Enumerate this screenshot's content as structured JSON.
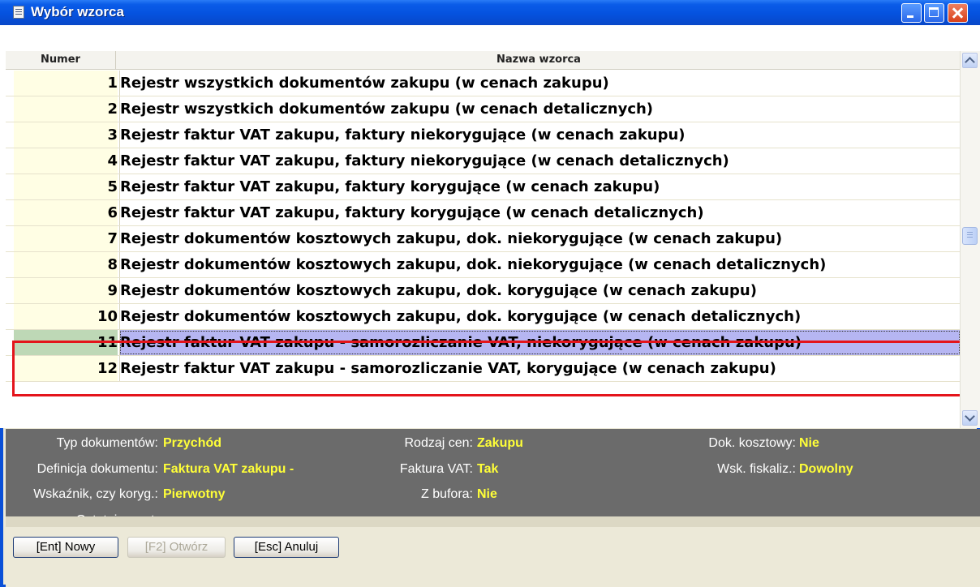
{
  "window": {
    "title": "Wybór wzorca"
  },
  "table": {
    "columns": [
      "Numer",
      "Nazwa wzorca"
    ],
    "selected_index": 10,
    "rows": [
      {
        "number": "1",
        "name": "Rejestr wszystkich dokumentów zakupu (w cenach zakupu)"
      },
      {
        "number": "2",
        "name": "Rejestr wszystkich dokumentów zakupu (w cenach detalicznych)"
      },
      {
        "number": "3",
        "name": "Rejestr faktur VAT zakupu, faktury niekorygujące (w cenach zakupu)"
      },
      {
        "number": "4",
        "name": "Rejestr faktur VAT zakupu, faktury niekorygujące (w cenach detalicznych)"
      },
      {
        "number": "5",
        "name": "Rejestr faktur VAT zakupu, faktury korygujące (w cenach zakupu)"
      },
      {
        "number": "6",
        "name": "Rejestr faktur VAT zakupu, faktury korygujące (w cenach detalicznych)"
      },
      {
        "number": "7",
        "name": "Rejestr dokumentów kosztowych zakupu, dok. niekorygujące (w cenach zakupu)"
      },
      {
        "number": "8",
        "name": "Rejestr dokumentów kosztowych zakupu, dok. niekorygujące (w cenach detalicznych)"
      },
      {
        "number": "9",
        "name": "Rejestr dokumentów kosztowych zakupu, dok. korygujące (w cenach zakupu)"
      },
      {
        "number": "10",
        "name": "Rejestr dokumentów kosztowych zakupu, dok. korygujące (w cenach detalicznych)"
      },
      {
        "number": "11",
        "name": "Rejestr faktur VAT zakupu - samorozliczanie VAT, niekorygujące (w cenach zakupu)"
      },
      {
        "number": "12",
        "name": "Rejestr faktur VAT zakupu - samorozliczanie VAT, korygujące (w cenach zakupu)"
      }
    ]
  },
  "details": {
    "typ_dokumentow": {
      "label": "Typ dokumentów:",
      "value": "Przychód"
    },
    "definicja_dokumentu": {
      "label": "Definicja dokumentu:",
      "value": "Faktura VAT zakupu -"
    },
    "wskaznik_koryg": {
      "label": "Wskaźnik, czy koryg.:",
      "value": "Pierwotny"
    },
    "ostatni_raport": {
      "label": "Ostatni raport:",
      "value": "-"
    },
    "rodzaj_cen": {
      "label": "Rodzaj cen:",
      "value": "Zakupu"
    },
    "faktura_vat": {
      "label": "Faktura VAT:",
      "value": "Tak"
    },
    "z_bufora": {
      "label": "Z bufora:",
      "value": "Nie"
    },
    "dok_kosztowy": {
      "label": "Dok. kosztowy:",
      "value": "Nie"
    },
    "wsk_fiskaliz": {
      "label": "Wsk. fiskaliz.:",
      "value": "Dowolny"
    }
  },
  "buttons": {
    "new": "[Ent] Nowy",
    "open": "[F2] Otwórz",
    "cancel": "[Esc] Anuluj"
  },
  "colors": {
    "title_bar": "#0552df",
    "selected_row": "#b6b6f2",
    "highlight_border": "#e4141b",
    "detail_value": "#ffff38",
    "detail_panel": "#6b6b6b"
  }
}
